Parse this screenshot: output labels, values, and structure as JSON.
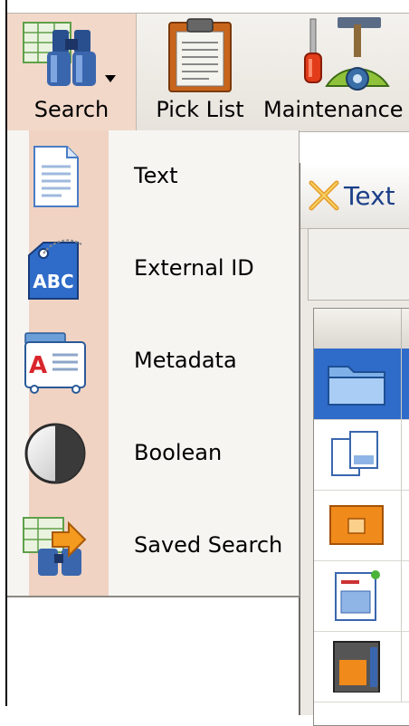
{
  "toolbar": {
    "search": {
      "label": "Search",
      "icon": "binoculars-icon"
    },
    "pick_list": {
      "label": "Pick List",
      "icon": "clipboard-icon"
    },
    "maintenance": {
      "label": "Maintenance",
      "icon": "tools-icon"
    }
  },
  "search_menu": {
    "items": [
      {
        "label": "Text",
        "icon": "text-document-icon"
      },
      {
        "label": "External ID",
        "icon": "abc-tag-icon"
      },
      {
        "label": "Metadata",
        "icon": "metadata-card-icon"
      },
      {
        "label": "Boolean",
        "icon": "boolean-circle-icon"
      },
      {
        "label": "Saved Search",
        "icon": "saved-search-binoculars-icon"
      }
    ]
  },
  "background_window": {
    "title": "Text"
  },
  "colors": {
    "menu_gutter": "#f0d3c3",
    "selection": "#2f6bc8",
    "title_text": "#1c3f88"
  }
}
